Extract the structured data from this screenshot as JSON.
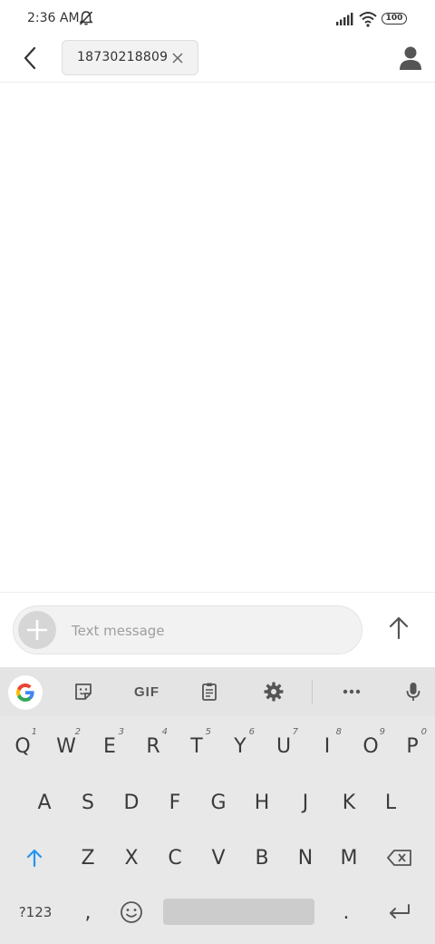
{
  "status_bar": {
    "time": "2:36 AM",
    "battery": "100",
    "icons": [
      "bell-off-icon",
      "signal-icon",
      "wifi-icon",
      "battery-icon"
    ]
  },
  "header": {
    "recipient": "18730218809",
    "icons": [
      "back-arrow-icon",
      "close-icon",
      "person-icon"
    ]
  },
  "compose": {
    "placeholder": "Text message",
    "icons": [
      "plus-icon",
      "send-arrow-icon"
    ]
  },
  "keyboard": {
    "toolbar": {
      "gif_label": "GIF",
      "icons": [
        "google-icon",
        "sticker-icon",
        "clipboard-icon",
        "gear-icon",
        "more-icon",
        "mic-icon"
      ]
    },
    "row1": [
      {
        "label": "Q",
        "hint": "1"
      },
      {
        "label": "W",
        "hint": "2"
      },
      {
        "label": "E",
        "hint": "3"
      },
      {
        "label": "R",
        "hint": "4"
      },
      {
        "label": "T",
        "hint": "5"
      },
      {
        "label": "Y",
        "hint": "6"
      },
      {
        "label": "U",
        "hint": "7"
      },
      {
        "label": "I",
        "hint": "8"
      },
      {
        "label": "O",
        "hint": "9"
      },
      {
        "label": "P",
        "hint": "0"
      }
    ],
    "row2": [
      "A",
      "S",
      "D",
      "F",
      "G",
      "H",
      "J",
      "K",
      "L"
    ],
    "row3": [
      "Z",
      "X",
      "C",
      "V",
      "B",
      "N",
      "M"
    ],
    "symbols_label": "?123",
    "comma_label": ",",
    "period_label": ".",
    "accent_color": "#2196f3"
  }
}
